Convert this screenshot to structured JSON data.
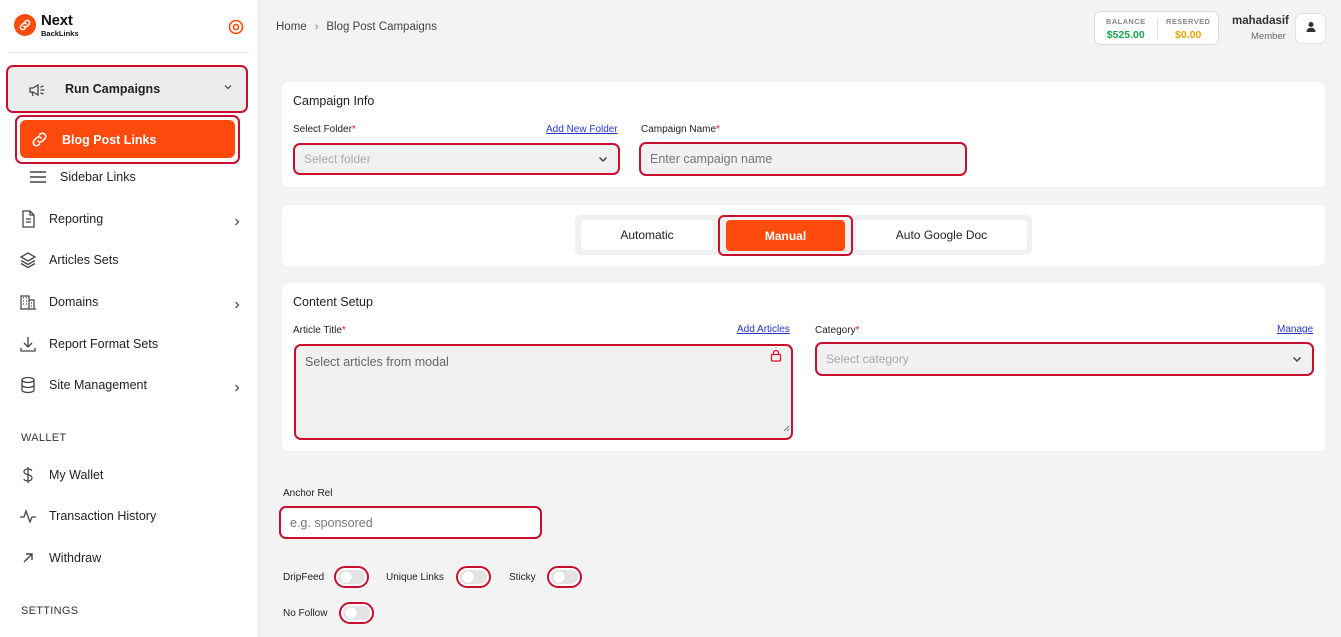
{
  "brand": {
    "name_line1": "Next",
    "name_line2": "BackLinks",
    "accent": "#ff4a0d",
    "highlight": "#c8102e"
  },
  "sidebar": {
    "run_campaigns": "Run Campaigns",
    "blog_post_links": "Blog Post Links",
    "sidebar_links": "Sidebar Links",
    "items": [
      {
        "label": "Reporting",
        "icon": "document-icon"
      },
      {
        "label": "Articles Sets",
        "icon": "layers-icon"
      },
      {
        "label": "Domains",
        "icon": "building-icon"
      },
      {
        "label": "Report Format Sets",
        "icon": "download-icon"
      },
      {
        "label": "Site Management",
        "icon": "database-icon"
      }
    ],
    "wallet_heading": "WALLET",
    "wallet_items": [
      {
        "label": "My Wallet",
        "icon": "dollar-icon"
      },
      {
        "label": "Transaction History",
        "icon": "activity-icon"
      },
      {
        "label": "Withdraw",
        "icon": "arrow-up-right-icon"
      }
    ],
    "settings_heading": "SETTINGS"
  },
  "header": {
    "breadcrumb": {
      "home": "Home",
      "sep": "›",
      "current": "Blog Post Campaigns"
    },
    "balance_label": "BALANCE",
    "balance_value": "$525.00",
    "reserved_label": "RESERVED",
    "reserved_value": "$0.00",
    "username": "mahadasif",
    "role": "Member"
  },
  "campaign_info": {
    "title": "Campaign Info",
    "folder_label": "Select Folder",
    "add_folder": "Add New Folder",
    "folder_placeholder": "Select folder",
    "name_label": "Campaign Name",
    "name_placeholder": "Enter campaign name",
    "required_mark": "*"
  },
  "mode_tabs": {
    "automatic": "Automatic",
    "manual": "Manual",
    "auto_doc": "Auto Google Doc",
    "selected": "Manual"
  },
  "content_setup": {
    "title": "Content Setup",
    "article_label": "Article Title",
    "add_articles": "Add Articles",
    "article_placeholder": "Select articles from modal",
    "category_label": "Category",
    "manage": "Manage",
    "category_placeholder": "Select category"
  },
  "options": {
    "anchor_rel_label": "Anchor Rel",
    "anchor_rel_placeholder": "e.g. sponsored",
    "dripfeed": "DripFeed",
    "unique_links": "Unique Links",
    "sticky": "Sticky",
    "no_follow": "No Follow"
  }
}
